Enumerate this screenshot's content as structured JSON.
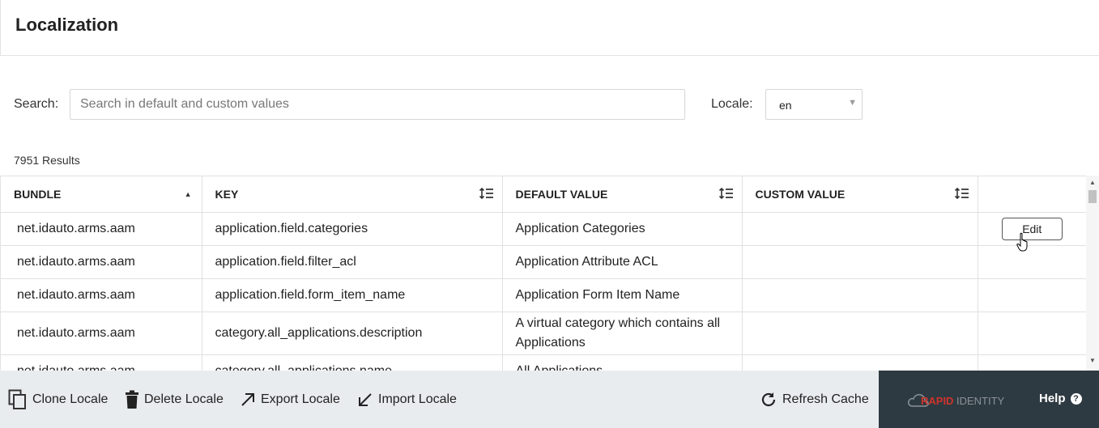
{
  "page": {
    "title": "Localization"
  },
  "search": {
    "label": "Search:",
    "placeholder": "Search in default and custom values",
    "value": ""
  },
  "locale": {
    "label": "Locale:",
    "value": "en"
  },
  "results": {
    "count_text": "7951 Results"
  },
  "table": {
    "headers": {
      "bundle": "BUNDLE",
      "key": "KEY",
      "default_value": "DEFAULT VALUE",
      "custom_value": "CUSTOM VALUE"
    },
    "sort": {
      "column": "bundle",
      "direction": "ascending"
    },
    "rows": [
      {
        "bundle": "net.idauto.arms.aam",
        "key": "application.field.categories",
        "default_value": "Application Categories",
        "custom_value": ""
      },
      {
        "bundle": "net.idauto.arms.aam",
        "key": "application.field.filter_acl",
        "default_value": "Application Attribute ACL",
        "custom_value": ""
      },
      {
        "bundle": "net.idauto.arms.aam",
        "key": "application.field.form_item_name",
        "default_value": "Application Form Item Name",
        "custom_value": ""
      },
      {
        "bundle": "net.idauto.arms.aam",
        "key": "category.all_applications.description",
        "default_value": "A virtual category which contains all Applications",
        "custom_value": ""
      },
      {
        "bundle": "net.idauto.arms.aam",
        "key": "category.all_applications.name",
        "default_value": "All Applications",
        "custom_value": ""
      }
    ],
    "edit_label": "Edit"
  },
  "footer": {
    "clone_label": "Clone Locale",
    "delete_label": "Delete Locale",
    "export_label": "Export Locale",
    "import_label": "Import Locale",
    "refresh_label": "Refresh Cache",
    "help_label": "Help",
    "brand_logo": {
      "part1": "RAPID",
      "part2": "IDENTITY"
    }
  },
  "colors": {
    "footer_bg": "#e9ecef",
    "brand_bg": "#2e3a41",
    "logo_accent": "#d0342c"
  }
}
